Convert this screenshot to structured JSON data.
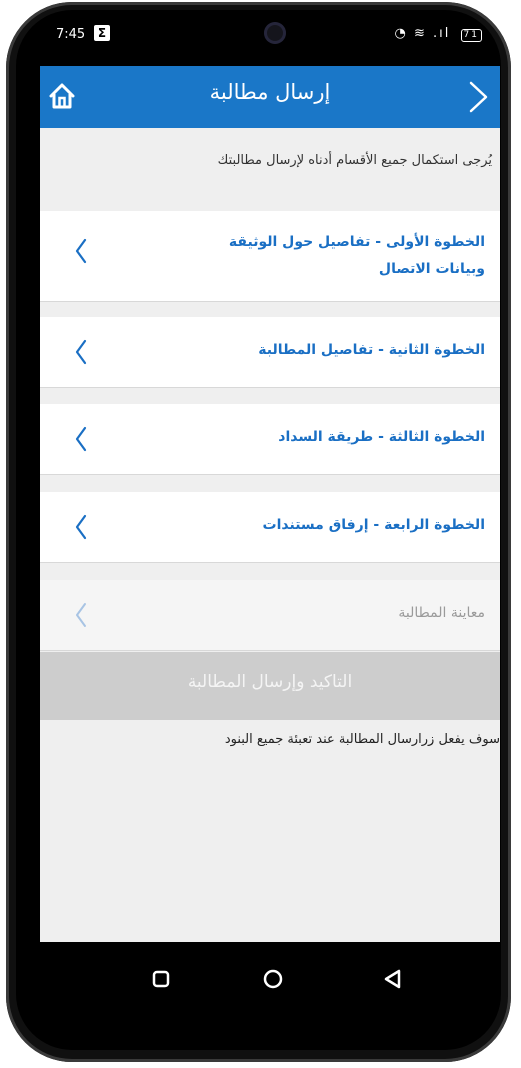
{
  "status_bar": {
    "time": "7:45",
    "notification_icon": "sigma-icon",
    "right_icons_text": "◔ ≋ .ıl",
    "battery_level": "71"
  },
  "app_bar": {
    "title": "إرسال مطالبة",
    "left_icon": "home-icon",
    "right_icon": "chevron-right-icon",
    "background": "#1a77c8"
  },
  "intro_text": "يُرجى استكمال جميع الأقسام أدناه لإرسال مطالبتك",
  "steps": [
    {
      "label": "الخطوة الأولى - تفاصيل حول الوثيقة وبيانات الاتصال",
      "enabled": true
    },
    {
      "label": "الخطوة الثانية - تفاصيل المطالبة",
      "enabled": true
    },
    {
      "label": "الخطوة الثالثة - طريقة السداد",
      "enabled": true
    },
    {
      "label": "الخطوة الرابعة - إرفاق مستندات",
      "enabled": true
    },
    {
      "label": "معاينة المطالبة",
      "enabled": false
    }
  ],
  "submit_button": {
    "label": "التاكيد وإرسال المطالبة",
    "enabled": false
  },
  "note": "سوف يفعل زرارسال المطالبة عند تعبئة جميع البنود",
  "nav_bar": {
    "buttons": [
      "recents-icon",
      "home-circle-icon",
      "back-triangle-icon"
    ]
  },
  "colors": {
    "accent": "#1a6fc4",
    "disabled_text": "#9a9a9a",
    "disabled_button": "#cdcdcd"
  }
}
